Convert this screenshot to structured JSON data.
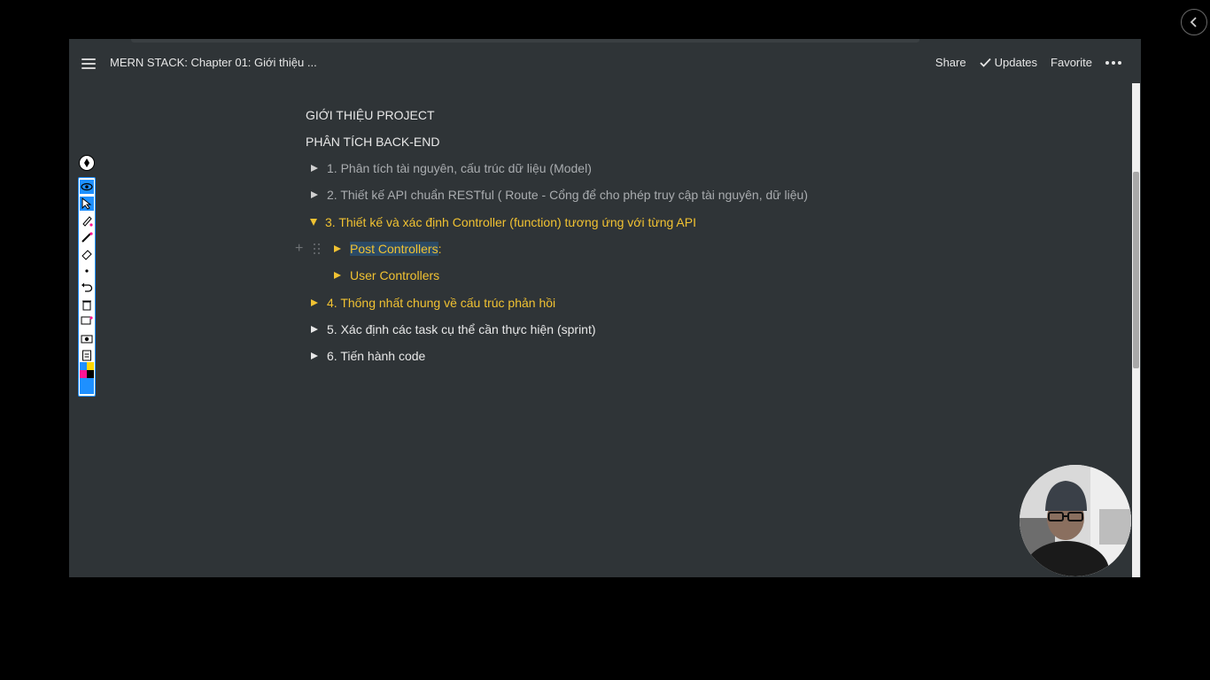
{
  "topbar": {
    "title": "MERN STACK: Chapter 01: Giới thiệu ...",
    "share_label": "Share",
    "updates_label": "Updates",
    "favorite_label": "Favorite"
  },
  "document": {
    "headings": [
      "GIỚI THIỆU PROJECT",
      "PHÂN TÍCH BACK-END"
    ],
    "items": [
      {
        "label": "1. Phân tích tài nguyên, cấu trúc dữ liệu (Model)",
        "state": "collapsed",
        "color": "#a9acaf"
      },
      {
        "label": "2. Thiết kế API chuẩn RESTful ( Route - Cổng để cho phép truy cập tài nguyên, dữ liệu)",
        "state": "collapsed",
        "color": "#a9acaf"
      },
      {
        "label": "3. Thiết kế và xác định Controller (function) tương ứng với từng API",
        "state": "expanded",
        "color": "#f1c232"
      },
      {
        "label": "4. Thống nhất chung về cấu trúc phản hồi",
        "state": "collapsed",
        "color": "#f1c232"
      },
      {
        "label": "5. Xác định các task cụ thể cần thực hiện (sprint)",
        "state": "collapsed",
        "color": "#e8e8e8"
      },
      {
        "label": "6. Tiến hành code",
        "state": "collapsed",
        "color": "#e8e8e8"
      }
    ],
    "subitems": [
      {
        "label_selected": "Post Controllers",
        "label_rest": ":",
        "state": "collapsed"
      },
      {
        "label_selected": "User Controllers",
        "label_rest": "",
        "state": "collapsed"
      }
    ]
  },
  "colors": {
    "page_bg": "#2f3437",
    "accent_yellow": "#f1c232",
    "selection": "#2b4a66",
    "toolbar_blue": "#1e90ff"
  },
  "annotation_toolbar": {
    "tools": [
      "pen-logo-icon",
      "eye-icon",
      "cursor-icon",
      "highlighter-icon",
      "pencil-icon",
      "eraser-icon",
      "dot-icon",
      "undo-icon",
      "trash-icon",
      "whiteboard-icon",
      "camera-icon",
      "clipboard-icon"
    ],
    "palette": [
      "#ffd700",
      "#000000",
      "#ff1493",
      "#000000",
      "#1e90ff",
      "#1e90ff"
    ]
  }
}
